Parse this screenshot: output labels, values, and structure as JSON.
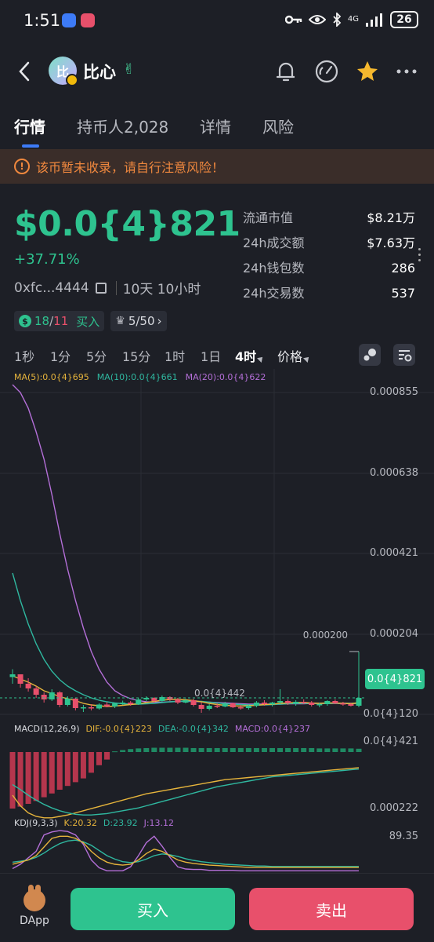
{
  "status_bar": {
    "time": "1:51",
    "network": "4G",
    "battery": "26"
  },
  "header": {
    "token_name": "比心",
    "avatar_letter": "比"
  },
  "tabs": [
    {
      "label": "行情",
      "active": true
    },
    {
      "label": "持币人2,028",
      "active": false
    },
    {
      "label": "详情",
      "active": false
    },
    {
      "label": "风险",
      "active": false
    }
  ],
  "warning": {
    "text": "该币暂未收录，请自行注意风险！"
  },
  "price": {
    "value": "$0.0{4}821",
    "change": "+37.71%",
    "address": "0xfc...4444",
    "age": "10天 10小时"
  },
  "stats": [
    {
      "label": "流通市值",
      "value": "$8.21万"
    },
    {
      "label": "24h成交额",
      "value": "$7.63万"
    },
    {
      "label": "24h钱包数",
      "value": "286"
    },
    {
      "label": "24h交易数",
      "value": "537"
    }
  ],
  "badges": {
    "buys": "18",
    "sells": "11",
    "buy_label": "买入",
    "rank": "5/50"
  },
  "intervals": [
    {
      "label": "1秒",
      "active": false
    },
    {
      "label": "1分",
      "active": false
    },
    {
      "label": "5分",
      "active": false
    },
    {
      "label": "15分",
      "active": false
    },
    {
      "label": "1时",
      "active": false
    },
    {
      "label": "1日",
      "active": false
    },
    {
      "label": "4时",
      "active": true
    },
    {
      "label": "价格",
      "active": false
    }
  ],
  "ma_legend": {
    "ma5": "MA(5):0.0{4}695",
    "ma10": "MA(10):0.0{4}661",
    "ma20": "MA(20):0.0{4}622"
  },
  "macd_legend": {
    "title": "MACD(12,26,9)",
    "dif": "DIF:-0.0{4}223",
    "dea": "DEA:-0.0{4}342",
    "macd": "MACD:0.0{4}237"
  },
  "kdj_legend": {
    "title": "KDJ(9,3,3)",
    "k": "K:20.32",
    "d": "D:23.92",
    "j": "J:13.12"
  },
  "colors": {
    "up": "#2ec38f",
    "down": "#e8506b",
    "ma5": "#e6b43c",
    "ma10": "#2fb8a0",
    "ma20": "#b46fd8",
    "accent": "#3d7bf7",
    "warning": "#f0883e"
  },
  "chart_data": {
    "type": "candlestick",
    "y_ticks": [
      "0.000855",
      "0.000638",
      "0.000421",
      "0.000204"
    ],
    "min_label": "0.0{4}120",
    "max_marker": "0.000200",
    "low_marker": "0.0{4}442",
    "current_price_tag": "0.0{4}821",
    "macd_axis": {
      "top": "0.0{4}421",
      "bottom": "0.000222"
    },
    "kdj_axis_top": "89.35",
    "candles": [
      [
        0.000135,
        0.000155,
        0.000118,
        0.000142
      ],
      [
        0.000142,
        0.00014,
        0.000108,
        0.000118
      ],
      [
        0.000118,
        0.000132,
        9.8e-05,
        0.000106
      ],
      [
        0.000106,
        0.000112,
        8.2e-05,
        9e-05
      ],
      [
        9e-05,
        9.6e-05,
        7e-05,
        7.8e-05
      ],
      [
        7.8e-05,
        0.000104,
        7.4e-05,
        9.6e-05
      ],
      [
        9.6e-05,
        9.9e-05,
        5.8e-05,
        6.4e-05
      ],
      [
        6.4e-05,
        8.6e-05,
        6e-05,
        8e-05
      ],
      [
        8e-05,
        8.2e-05,
        5e-05,
        5.6e-05
      ],
      [
        5.6e-05,
        6.4e-05,
        4.6e-05,
        5.8e-05
      ],
      [
        5.8e-05,
        6.6e-05,
        5e-05,
        5.5e-05
      ],
      [
        5.5e-05,
        6.8e-05,
        5.2e-05,
        6.5e-05
      ],
      [
        6.5e-05,
        7.2e-05,
        5.8e-05,
        6e-05
      ],
      [
        6e-05,
        7e-05,
        5.6e-05,
        6.8e-05
      ],
      [
        6.8e-05,
        7.5e-05,
        6.4e-05,
        7e-05
      ],
      [
        7e-05,
        7.4e-05,
        6.2e-05,
        6.6e-05
      ],
      [
        6.6e-05,
        8.2e-05,
        6.4e-05,
        7.8e-05
      ],
      [
        7.8e-05,
        8.6e-05,
        7.4e-05,
        8.2e-05
      ],
      [
        8.2e-05,
        8.4e-05,
        7e-05,
        7.4e-05
      ],
      [
        7.4e-05,
        8.8e-05,
        7.2e-05,
        8.4e-05
      ],
      [
        8.4e-05,
        8.6e-05,
        7.4e-05,
        7.8e-05
      ],
      [
        7.8e-05,
        8.2e-05,
        6.6e-05,
        7e-05
      ],
      [
        7e-05,
        8e-05,
        6.8e-05,
        7.6e-05
      ],
      [
        7.6e-05,
        8e-05,
        6e-05,
        6.4e-05
      ],
      [
        6.4e-05,
        7e-05,
        4.4e-05,
        5.4e-05
      ],
      [
        5.4e-05,
        6.6e-05,
        5e-05,
        6.2e-05
      ],
      [
        6.2e-05,
        6.8e-05,
        5.6e-05,
        6e-05
      ],
      [
        6e-05,
        7.2e-05,
        5.8e-05,
        6.8e-05
      ],
      [
        6.8e-05,
        7e-05,
        5.6e-05,
        5.8e-05
      ],
      [
        5.8e-05,
        6.4e-05,
        5.2e-05,
        5.6e-05
      ],
      [
        5.6e-05,
        6.4e-05,
        5.2e-05,
        6.2e-05
      ],
      [
        6.2e-05,
        7.4e-05,
        5.8e-05,
        7e-05
      ],
      [
        7e-05,
        7.6e-05,
        6.2e-05,
        6.6e-05
      ],
      [
        6.6e-05,
        7.2e-05,
        6e-05,
        7e-05
      ],
      [
        7e-05,
        0.000104,
        6.6e-05,
        7.4e-05
      ],
      [
        7.4e-05,
        7.8e-05,
        6.4e-05,
        6.8e-05
      ],
      [
        6.8e-05,
        7.6e-05,
        6.2e-05,
        7.2e-05
      ],
      [
        7.2e-05,
        7.8e-05,
        6.6e-05,
        7e-05
      ],
      [
        7e-05,
        7.4e-05,
        6e-05,
        6.4e-05
      ],
      [
        6.4e-05,
        7e-05,
        5.8e-05,
        6.6e-05
      ],
      [
        6.6e-05,
        7.6e-05,
        6.2e-05,
        7.4e-05
      ],
      [
        7.4e-05,
        7.8e-05,
        6.6e-05,
        6.8e-05
      ],
      [
        6.8e-05,
        7.2e-05,
        6.2e-05,
        6.6e-05
      ],
      [
        6.6e-05,
        7e-05,
        6e-05,
        6.2e-05
      ],
      [
        6.2e-05,
        0.0002,
        5.8e-05,
        8.2e-05
      ]
    ],
    "ma5": [
      0.000138,
      0.00013,
      0.000122,
      0.000112,
      0.0001,
      9.3e-05,
      8.5e-05,
      8e-05,
      7.5e-05,
      6.8e-05,
      6.4e-05,
      6.2e-05,
      6e-05,
      6.1e-05,
      6.3e-05,
      6.5e-05,
      6.7e-05,
      7e-05,
      7.3e-05,
      7.6e-05,
      7.8e-05,
      7.8e-05,
      7.7e-05,
      7.5e-05,
      7.2e-05,
      6.8e-05,
      6.5e-05,
      6.3e-05,
      6.2e-05,
      6.1e-05,
      6.2e-05,
      6.3e-05,
      6.5e-05,
      6.6e-05,
      6.8e-05,
      6.9e-05,
      7e-05,
      7e-05,
      6.9e-05,
      6.8e-05,
      6.9e-05,
      6.9e-05,
      6.8e-05,
      6.7e-05,
      7e-05
    ],
    "ma10": [
      0.0004,
      0.00033,
      0.00027,
      0.00022,
      0.00018,
      0.00015,
      0.000128,
      0.000112,
      0.0001,
      9e-05,
      8.2e-05,
      7.6e-05,
      7.2e-05,
      6.9e-05,
      6.7e-05,
      6.6e-05,
      6.6e-05,
      6.7e-05,
      6.8e-05,
      7e-05,
      7.2e-05,
      7.3e-05,
      7.4e-05,
      7.4e-05,
      7.3e-05,
      7.1e-05,
      6.9e-05,
      6.7e-05,
      6.6e-05,
      6.5e-05,
      6.4e-05,
      6.4e-05,
      6.4e-05,
      6.5e-05,
      6.6e-05,
      6.7e-05,
      6.8e-05,
      6.8e-05,
      6.8e-05,
      6.8e-05,
      6.8e-05,
      6.8e-05,
      6.8e-05,
      6.8e-05,
      6.8e-05
    ],
    "ma20": [
      0.00088,
      0.00086,
      0.00082,
      0.00076,
      0.00069,
      0.0006,
      0.0005,
      0.00041,
      0.00033,
      0.00026,
      0.0002,
      0.000155,
      0.000122,
      0.0001,
      8.8e-05,
      8e-05,
      7.5e-05,
      7.2e-05,
      7.1e-05,
      7.1e-05,
      7.2e-05,
      7.3e-05,
      7.3e-05,
      7.3e-05,
      7.2e-05,
      7.1e-05,
      7e-05,
      6.9e-05,
      6.8e-05,
      6.7e-05,
      6.6e-05,
      6.6e-05,
      6.6e-05,
      6.6e-05,
      6.6e-05,
      6.7e-05,
      6.7e-05,
      6.7e-05,
      6.8e-05,
      6.8e-05,
      6.8e-05,
      6.8e-05,
      6.8e-05,
      6.8e-05,
      6.8e-05
    ],
    "macd_hist": [
      -60,
      -58,
      -55,
      -52,
      -48,
      -44,
      -40,
      -36,
      -32,
      -28,
      -22,
      -14,
      -8,
      2,
      6,
      9,
      11,
      12,
      13,
      13,
      13,
      13,
      13,
      12,
      12,
      12,
      12,
      12,
      12,
      12,
      12,
      12,
      12,
      12,
      12,
      12,
      12,
      12,
      12,
      11,
      11,
      11,
      11,
      11,
      10
    ],
    "macd_dif": [
      -20,
      -35,
      -45,
      -50,
      -52,
      -52,
      -50,
      -48,
      -45,
      -42,
      -39,
      -36,
      -33,
      -30,
      -27,
      -24,
      -21,
      -18,
      -16,
      -14,
      -12,
      -10,
      -8,
      -6,
      -4,
      -2,
      0,
      2,
      3,
      4,
      5,
      6,
      7,
      8,
      9,
      10,
      11,
      12,
      13,
      14,
      15,
      16,
      17,
      18,
      19
    ],
    "macd_dea": [
      -5,
      -12,
      -20,
      -27,
      -33,
      -38,
      -42,
      -45,
      -47,
      -48,
      -48,
      -47,
      -46,
      -44,
      -42,
      -40,
      -38,
      -35,
      -32,
      -29,
      -26,
      -23,
      -20,
      -17,
      -14,
      -11,
      -8,
      -6,
      -4,
      -2,
      0,
      2,
      4,
      6,
      7,
      8,
      9,
      10,
      11,
      12,
      13,
      14,
      15,
      16,
      17
    ],
    "kdj_k": [
      20,
      25,
      30,
      40,
      60,
      80,
      85,
      85,
      80,
      70,
      50,
      35,
      25,
      20,
      18,
      20,
      30,
      45,
      55,
      50,
      40,
      30,
      25,
      22,
      20,
      18,
      17,
      16,
      15,
      14,
      13,
      13,
      13,
      13,
      13,
      13,
      13,
      13,
      13,
      13,
      13,
      13,
      13,
      13,
      13
    ],
    "kdj_d": [
      25,
      27,
      30,
      36,
      46,
      58,
      68,
      74,
      76,
      72,
      64,
      52,
      40,
      32,
      26,
      24,
      26,
      32,
      40,
      44,
      42,
      38,
      33,
      29,
      26,
      24,
      22,
      20,
      19,
      18,
      17,
      16,
      16,
      15,
      15,
      15,
      15,
      15,
      15,
      15,
      15,
      15,
      15,
      15,
      15
    ],
    "kdj_j": [
      10,
      20,
      35,
      50,
      88,
      95,
      98,
      96,
      88,
      66,
      30,
      12,
      5,
      5,
      5,
      14,
      40,
      70,
      85,
      62,
      36,
      14,
      9,
      8,
      8,
      6,
      6,
      6,
      6,
      5,
      5,
      5,
      5,
      5,
      5,
      5,
      5,
      5,
      5,
      5,
      5,
      5,
      5,
      5,
      5
    ]
  }
}
